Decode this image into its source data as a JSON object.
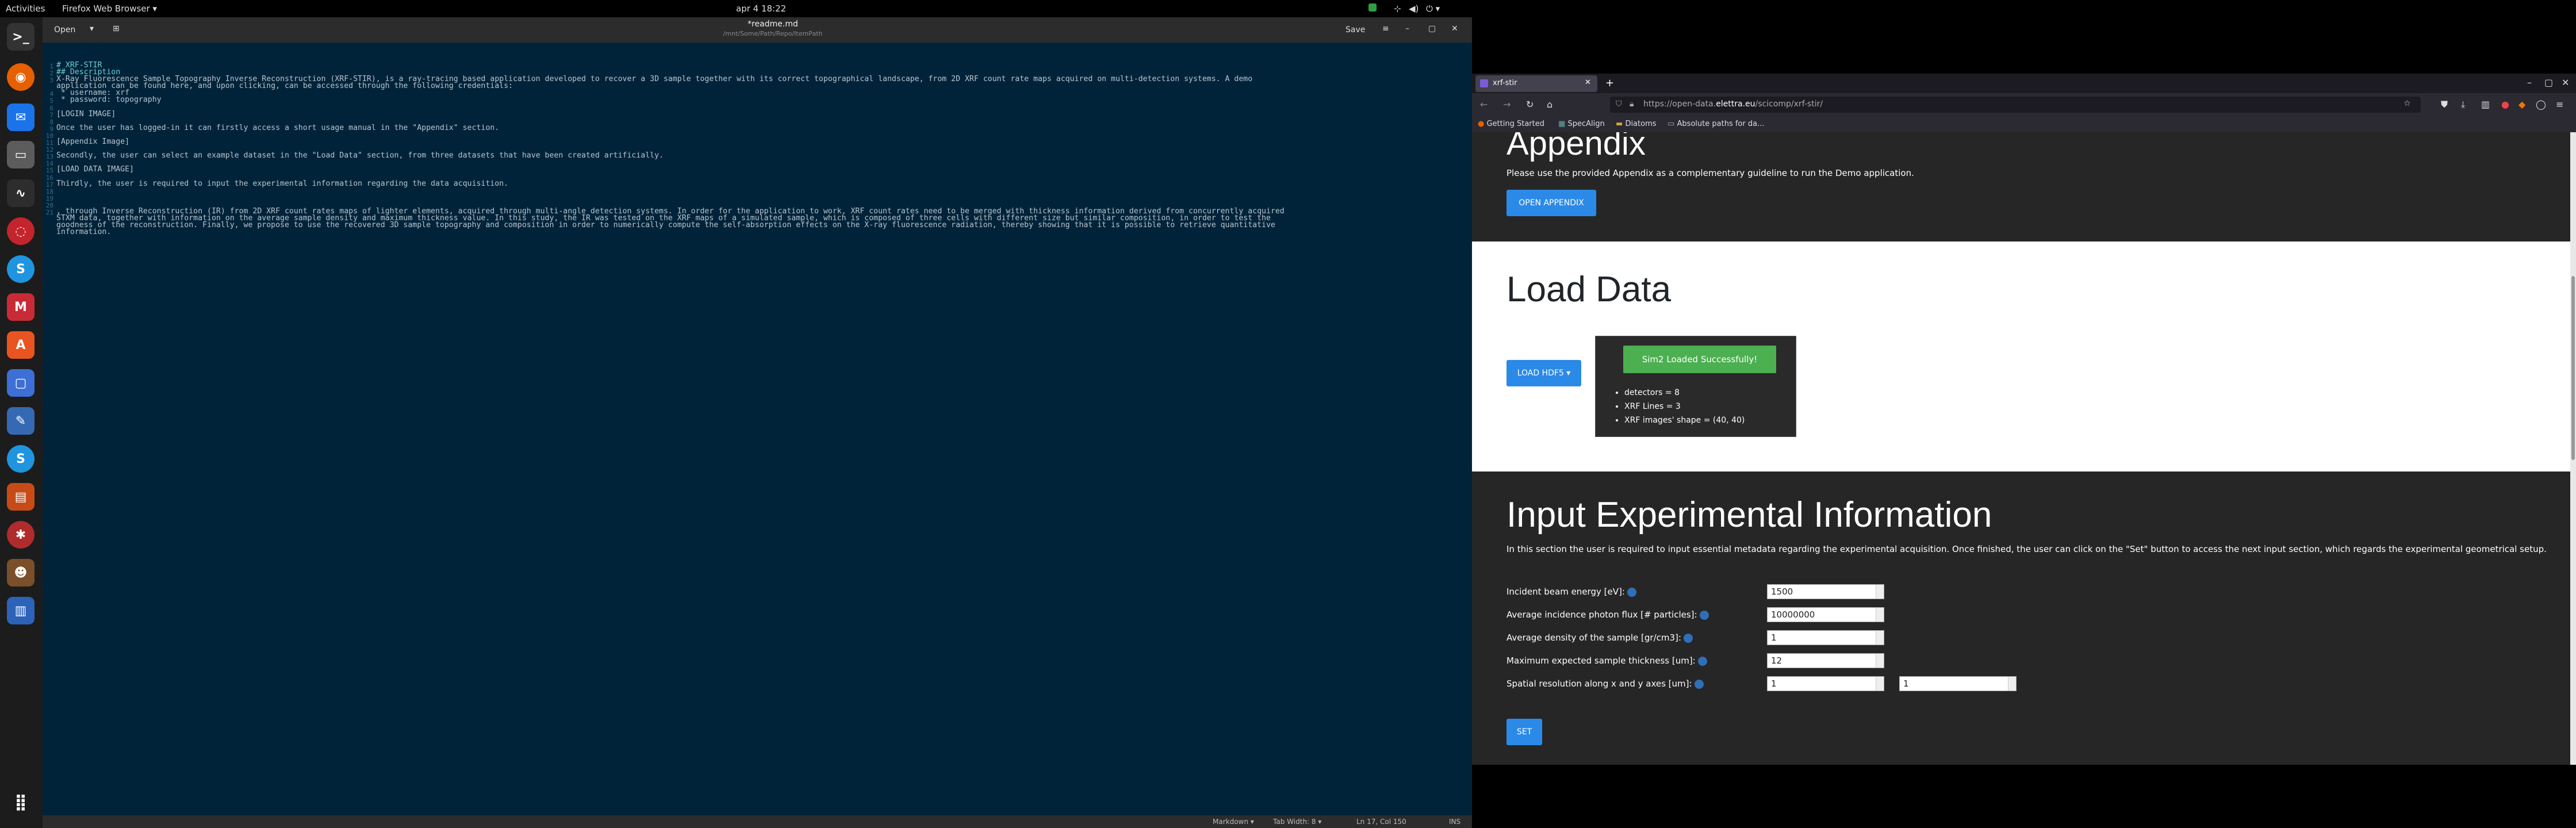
{
  "topbar": {
    "activities": "Activities",
    "app": "Firefox Web Browser ▾",
    "clock": "apr 4  18:22"
  },
  "editor": {
    "open_label": "Open",
    "file_title": "*readme.md",
    "file_path": "/mnt/Some/Path/Repo/ItemPath",
    "save_label": "Save",
    "lines": [
      "1",
      "2",
      "3",
      "",
      "4",
      "5",
      "6",
      "7",
      "8",
      "9",
      "10",
      "11",
      "12",
      "13",
      "14",
      "15",
      "16",
      "17",
      "18",
      "19",
      "20",
      "21",
      "",
      "",
      ""
    ],
    "code": [
      {
        "t": "# XRF-STIR",
        "h": true
      },
      {
        "t": "## Description",
        "h": true
      },
      {
        "t": "X-Ray Fluorescence Sample Topography Inverse Reconstruction (XRF-STIR), is a ray-tracing based application developed to recover a 3D sample together with its correct topographical landscape, from 2D XRF count rate maps acquired on multi-detection systems. A demo",
        "h": false
      },
      {
        "t": "application can be found here, and upon clicking, can be accessed through the following credentials:",
        "h": false
      },
      {
        "t": " * username: xrf",
        "h": false
      },
      {
        "t": " * password: topography",
        "h": false
      },
      {
        "t": "",
        "h": false
      },
      {
        "t": "[LOGIN IMAGE]",
        "h": false
      },
      {
        "t": "",
        "h": false
      },
      {
        "t": "Once the user has logged-in it can firstly access a short usage manual in the \"Appendix\" section.",
        "h": false
      },
      {
        "t": "",
        "h": false
      },
      {
        "t": "[Appendix Image]",
        "h": false
      },
      {
        "t": "",
        "h": false
      },
      {
        "t": "Secondly, the user can select an example dataset in the \"Load Data\" section, from three datasets that have been created artificially.",
        "h": false
      },
      {
        "t": "",
        "h": false
      },
      {
        "t": "[LOAD DATA IMAGE]",
        "h": false
      },
      {
        "t": "",
        "h": false
      },
      {
        "t": "Thirdly, the user is required to input the experimental information regarding the data acquisition.",
        "h": false
      },
      {
        "t": "",
        "h": false
      },
      {
        "t": "",
        "h": false
      },
      {
        "t": "",
        "h": false
      },
      {
        "t": ", through Inverse Reconstruction (IR) from 2D XRF count rates maps of lighter elements, acquired through multi-angle detection systems. In order for the application to work, XRF count rates need to be merged with thickness information derived from concurrently acquired",
        "h": false
      },
      {
        "t": "STXM data, together with information on the average sample density and maximum thickness value. In this study, the IR was tested on the XRF maps of a simulated sample, which is composed of three cells with different size but similar composition, in order to test the",
        "h": false
      },
      {
        "t": "goodness of the reconstruction. Finally, we propose to use the recovered 3D sample topography and composition in order to numerically compute the self-absorption effects on the X-ray fluorescence radiation, thereby showing that it is possible to retrieve quantitative",
        "h": false
      },
      {
        "t": "information.",
        "h": false
      }
    ],
    "status_lang": "Markdown ▾",
    "status_tab": "Tab Width: 8 ▾",
    "status_pos": "Ln 17, Col 150",
    "status_ins": "INS"
  },
  "browser": {
    "tab_title": "xrf-stir",
    "url_prefix": "https://open-data.",
    "url_domain": "elettra.eu",
    "url_suffix": "/scicomp/xrf-stir/",
    "bookmarks": [
      "Getting Started",
      "SpecAlign",
      "Diatoms",
      "Absolute paths for da..."
    ]
  },
  "page": {
    "appendix_title": "Appendix",
    "appendix_text": "Please use the provided Appendix as a complementary guideline to run the Demo application.",
    "appendix_button": "OPEN APPENDIX",
    "load_title": "Load Data",
    "load_button": "LOAD HDF5 ▾",
    "load_success": "Sim2 Loaded Successfully!",
    "load_items": [
      "detectors = 8",
      "XRF Lines = 3",
      "XRF images' shape = (40, 40)"
    ],
    "input_title": "Input Experimental Information",
    "input_text": "In this section the user is required to input essential metadata regarding the experimental acquisition. Once finished, the user can click on the \"Set\" button to access the next input section, which regards the experimental geometrical setup.",
    "fields": [
      {
        "label": "Incident beam energy [eV]:",
        "value": "1500"
      },
      {
        "label": "Average incidence photon flux [# particles]:",
        "value": "10000000"
      },
      {
        "label": "Average density of the sample [gr/cm3]:",
        "value": "1"
      },
      {
        "label": "Maximum expected sample thickness [um]:",
        "value": "12"
      },
      {
        "label": "Spatial resolution along x and y axes [um]:",
        "value": "1",
        "value2": "1"
      }
    ],
    "set_button": "SET"
  }
}
